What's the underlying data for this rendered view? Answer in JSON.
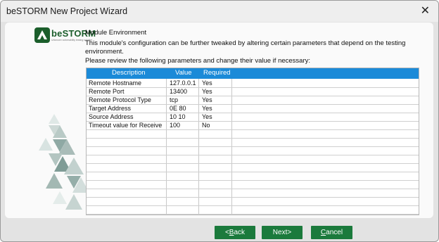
{
  "window": {
    "title": "beSTORM New Project Wizard",
    "close_symbol": "✕"
  },
  "logo": {
    "text": "beSTORM",
    "tagline": "Unknown vulnerability testing solution",
    "color": "#1b5e2b"
  },
  "content": {
    "heading": "Module Environment",
    "description": "This module's configuration can be further tweaked by altering certain parameters that depend on the testing environment.",
    "hint": "Please review the following parameters and change their value if necessary:"
  },
  "table": {
    "header_color": "#1b8ad8",
    "columns": [
      "Description",
      "Value",
      "Required"
    ],
    "rows": [
      [
        "Remote Hostname",
        "127.0.0.1",
        "Yes"
      ],
      [
        "Remote Port",
        "13400",
        "Yes"
      ],
      [
        "Remote Protocol Type",
        "tcp",
        "Yes"
      ],
      [
        "Target Address",
        "0E 80",
        "Yes"
      ],
      [
        "Source Address",
        "10 10",
        "Yes"
      ],
      [
        "Timeout value for Receive",
        "100",
        "No"
      ]
    ]
  },
  "buttons": {
    "back": {
      "prefix": "<",
      "mnemonic": "B",
      "rest": "ack"
    },
    "next": {
      "label": "Next>"
    },
    "cancel": {
      "mnemonic": "C",
      "rest": "ancel"
    },
    "color": "#1b7a3c"
  }
}
